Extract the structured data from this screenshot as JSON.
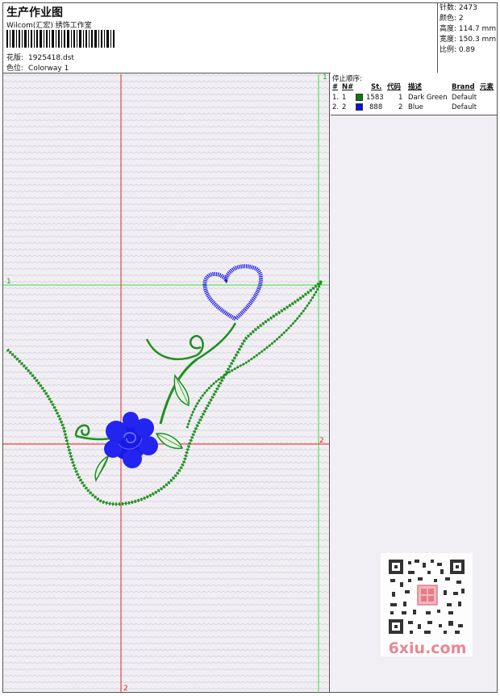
{
  "header": {
    "title": "生产作业图",
    "studio": "Wilcom(汇宏) 绣饰工作室",
    "pattern_label": "花版:",
    "pattern_value": "1925418.dst",
    "colorway_label": "色位:",
    "colorway_value": "Colorway 1"
  },
  "info": {
    "stitches_label": "针数:",
    "stitches_value": "2473",
    "colors_label": "颜色:",
    "colors_value": "2",
    "height_label": "高度:",
    "height_value": "114.7 mm",
    "width_label": "宽度:",
    "width_value": "150.3 mm",
    "scale_label": "比例:",
    "scale_value": "0.89"
  },
  "legend": {
    "title": "停止顺序:",
    "headers": [
      "#",
      "N#",
      "St.",
      "代码",
      "描述",
      "Brand",
      "元素"
    ],
    "rows": [
      {
        "num": "1.",
        "n": "1",
        "color": "#0a7a0a",
        "st": "1583",
        "code": "1",
        "desc": "Dark Green",
        "brand": "Default"
      },
      {
        "num": "2.",
        "n": "2",
        "color": "#1010e0",
        "st": "888",
        "code": "2",
        "desc": "Blue",
        "brand": "Default"
      }
    ]
  },
  "guides": {
    "v1": "1",
    "h1": "1",
    "h2": "2",
    "v2": "2"
  },
  "colors": {
    "green": "#1f8f1f",
    "blue": "#1a1ae6",
    "guide_green": "#3ddc3d",
    "guide_red": "#e62020"
  },
  "watermark": {
    "text": "6xiu.com"
  }
}
